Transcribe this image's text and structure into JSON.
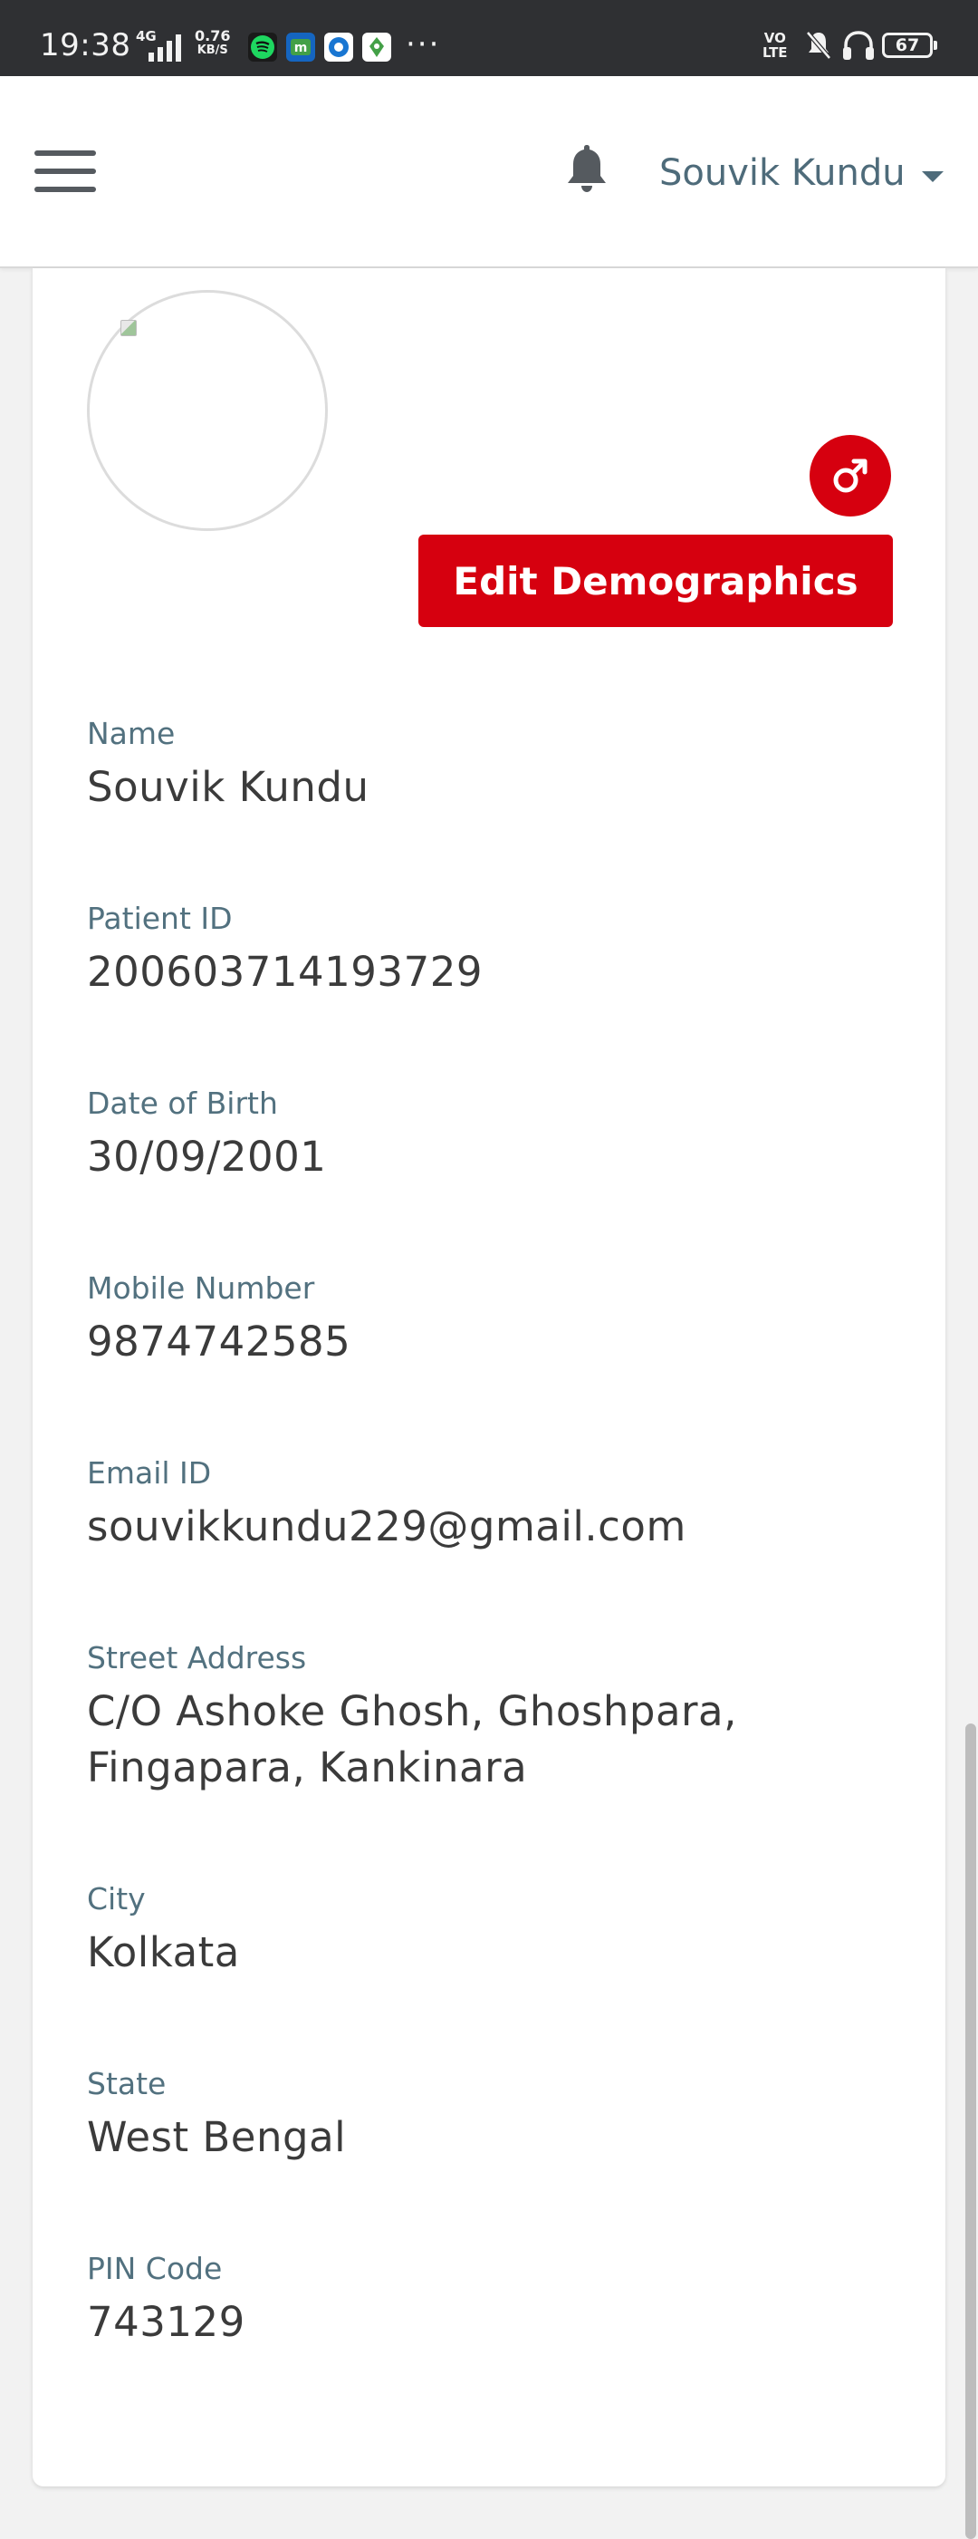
{
  "status_bar": {
    "time": "19:38",
    "network": "4G",
    "speed_value": "0.76",
    "speed_unit": "KB/S",
    "overflow": "···",
    "volte_top": "VO",
    "volte_bottom": "LTE",
    "battery": "67"
  },
  "header": {
    "user_name": "Souvik Kundu"
  },
  "profile": {
    "edit_button": "Edit Demographics",
    "fields": [
      {
        "label": "Name",
        "value": "Souvik Kundu"
      },
      {
        "label": "Patient ID",
        "value": "200603714193729"
      },
      {
        "label": "Date of Birth",
        "value": "30/09/2001"
      },
      {
        "label": "Mobile Number",
        "value": "9874742585"
      },
      {
        "label": "Email ID",
        "value": "souvikkundu229@gmail.com"
      },
      {
        "label": "Street Address",
        "value": "C/O Ashoke Ghosh, Ghoshpara, Fingapara, Kankinara"
      },
      {
        "label": "City",
        "value": "Kolkata"
      },
      {
        "label": "State",
        "value": "West Bengal"
      },
      {
        "label": "PIN Code",
        "value": "743129"
      }
    ]
  },
  "colors": {
    "accent": "#d6000f",
    "label": "#52717f",
    "value": "#3b3b3b",
    "status_bar": "#2f3033"
  },
  "icons": {
    "menu": "hamburger-icon",
    "notifications": "bell-icon",
    "gender": "male-symbol-icon"
  }
}
